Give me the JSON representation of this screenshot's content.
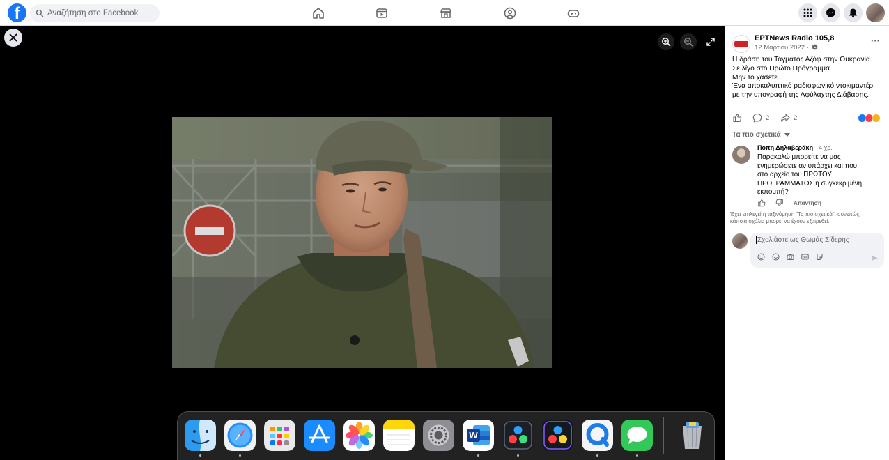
{
  "topbar": {
    "logo": "f",
    "search_placeholder": "Αναζήτηση στο Facebook",
    "nav_icons": [
      "home-icon",
      "video-icon",
      "marketplace-icon",
      "groups-icon",
      "gaming-icon"
    ],
    "right_icons": [
      "menu-grid-icon",
      "messenger-icon",
      "notifications-icon"
    ],
    "accent": "#1877f2"
  },
  "viewer": {
    "controls": [
      "close-icon",
      "zoom-in-icon",
      "zoom-out-icon",
      "fullscreen-icon"
    ]
  },
  "dock": {
    "apps": [
      "finder",
      "safari",
      "launchpad",
      "app-store",
      "photos",
      "notes",
      "system-preferences",
      "word",
      "davinci-resolve",
      "davinci-resolve",
      "quicktime",
      "messages"
    ],
    "trash": "trash"
  },
  "post": {
    "page_name": "EPTNews Radio 105,8",
    "date": "12 Μαρτίου 2022 ·",
    "more": "···",
    "text_lines": [
      "Η δράση του Τάγματος Αζόφ στην Ουκρανία.",
      "Σε λίγο στο Πρώτο Πρόγραμμα.",
      "Μην το χάσετε.",
      "Ένα αποκαλυπτικό ραδιοφωνικό ντοκιμαντέρ",
      "με την υπογραφή της Αφύλαχτης Διάβασης."
    ],
    "comment_count": "2",
    "share_count": "2",
    "sort_label": "Τα πιο σχετικά"
  },
  "comment": {
    "author": "Ποπη Δηλαβεράκη",
    "time": " · 4 χρ.",
    "text_lines": [
      "Παρακαλώ μπορείτε να μας",
      "ενημερώσετε αν υπάρχει και που",
      "στο αρχείο του ΠΡΩΤΟΥ",
      "ΠΡΟΓΡΑΜΜΑΤΟΣ η συγκεκριμένη",
      "εκπομπή?"
    ],
    "reply": "Απάντηση"
  },
  "note_lines": [
    "Έχει επιλεγεί η ταξινόμηση \"Τα πιο σχετικά\", συνεπώς",
    "κάποια σχόλια μπορεί να έχουν εξαιρεθεί."
  ],
  "composer": {
    "placeholder": "Σχολιάστε ως Θωμάς Σίδερης"
  }
}
